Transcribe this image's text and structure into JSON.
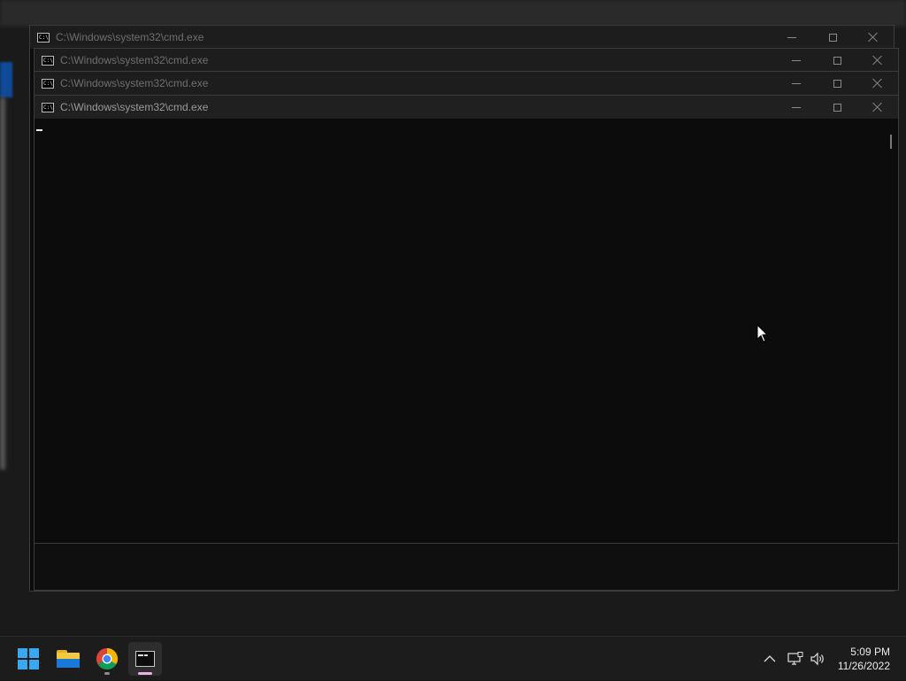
{
  "windows": [
    {
      "title": "C:\\Windows\\system32\\cmd.exe"
    },
    {
      "title": "C:\\Windows\\system32\\cmd.exe"
    },
    {
      "title": "C:\\Windows\\system32\\cmd.exe"
    },
    {
      "title": "C:\\Windows\\system32\\cmd.exe"
    }
  ],
  "taskbar": {
    "apps": [
      {
        "name": "Start",
        "icon": "windows-logo-icon"
      },
      {
        "name": "File Explorer",
        "icon": "folder-icon"
      },
      {
        "name": "Google Chrome",
        "icon": "chrome-icon"
      },
      {
        "name": "Command Prompt",
        "icon": "terminal-icon",
        "active": true
      }
    ],
    "tray_icons": [
      "chevron-up-icon",
      "network-icon",
      "volume-icon"
    ],
    "clock": {
      "time": "5:09 PM",
      "date": "11/26/2022"
    }
  },
  "colors": {
    "console_bg": "#0c0c0c",
    "titlebar_bg": "#202020",
    "taskbar_bg": "#1c1c1c",
    "accent_pink": "#e6b3e8",
    "windows_blue": "#3aa8f0"
  }
}
